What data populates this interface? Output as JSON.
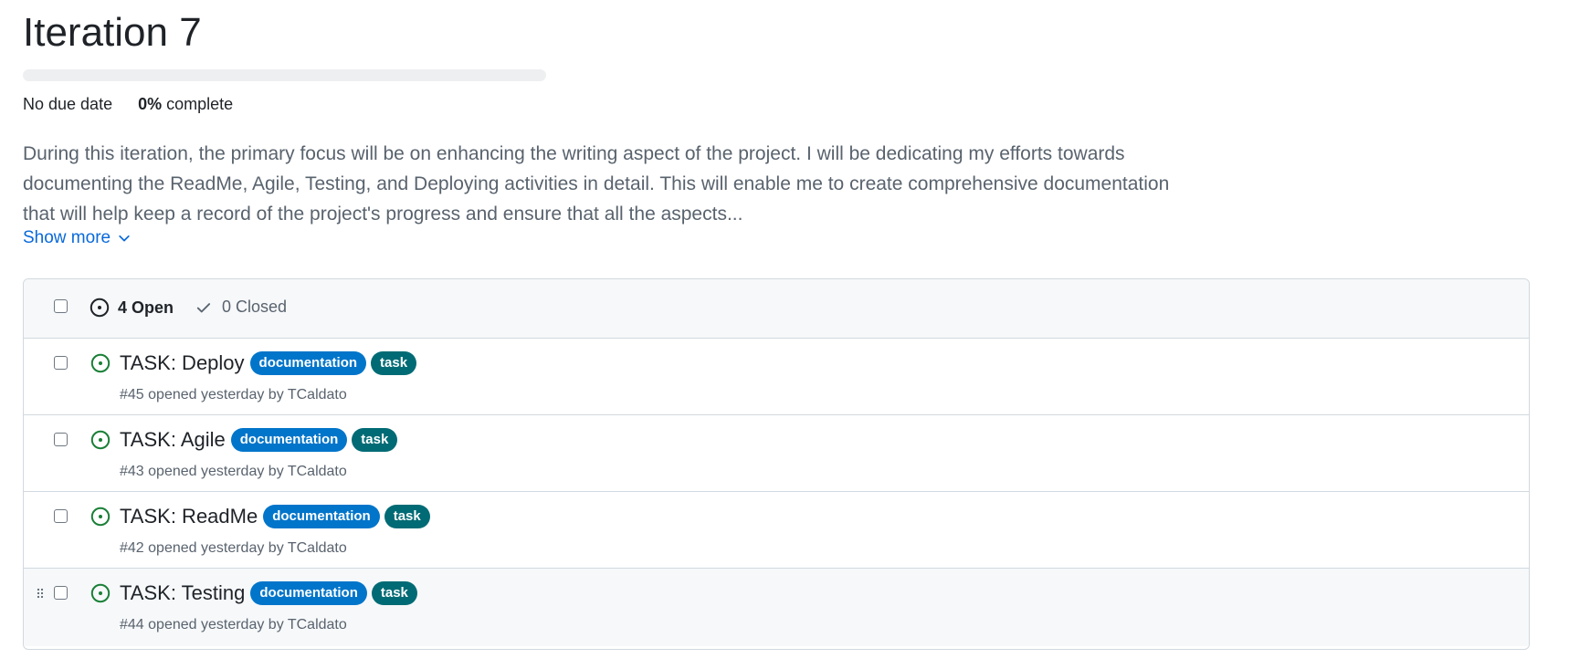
{
  "milestone": {
    "title": "Iteration 7",
    "progress_percent": 0,
    "due": "No due date",
    "complete_value": "0%",
    "complete_label": "complete",
    "description": "During this iteration, the primary focus will be on enhancing the writing aspect of the project. I will be dedicating my efforts towards documenting the ReadMe, Agile, Testing, and Deploying activities in detail. This will enable me to create comprehensive documentation that will help keep a record of the project's progress and ensure that all the aspects...",
    "show_more": "Show more"
  },
  "issue_list": {
    "header": {
      "open_label": "4 Open",
      "closed_label": "0 Closed"
    },
    "issues": [
      {
        "title": "TASK: Deploy",
        "labels": [
          {
            "name": "documentation",
            "color": "#0075ca"
          },
          {
            "name": "task",
            "color": "#006b75"
          }
        ],
        "meta": "#45 opened yesterday by TCaldato"
      },
      {
        "title": "TASK: Agile",
        "labels": [
          {
            "name": "documentation",
            "color": "#0075ca"
          },
          {
            "name": "task",
            "color": "#006b75"
          }
        ],
        "meta": "#43 opened yesterday by TCaldato"
      },
      {
        "title": "TASK: ReadMe",
        "labels": [
          {
            "name": "documentation",
            "color": "#0075ca"
          },
          {
            "name": "task",
            "color": "#006b75"
          }
        ],
        "meta": "#42 opened yesterday by TCaldato"
      },
      {
        "title": "TASK: Testing",
        "labels": [
          {
            "name": "documentation",
            "color": "#0075ca"
          },
          {
            "name": "task",
            "color": "#006b75"
          }
        ],
        "meta": "#44 opened yesterday by TCaldato"
      }
    ]
  },
  "colors": {
    "open_icon": "#1a7f37",
    "link": "#0969da"
  },
  "icons": {
    "open": "issue-opened-icon",
    "closed": "check-icon",
    "chevron": "chevron-down-icon",
    "drag": "grabber-icon"
  }
}
